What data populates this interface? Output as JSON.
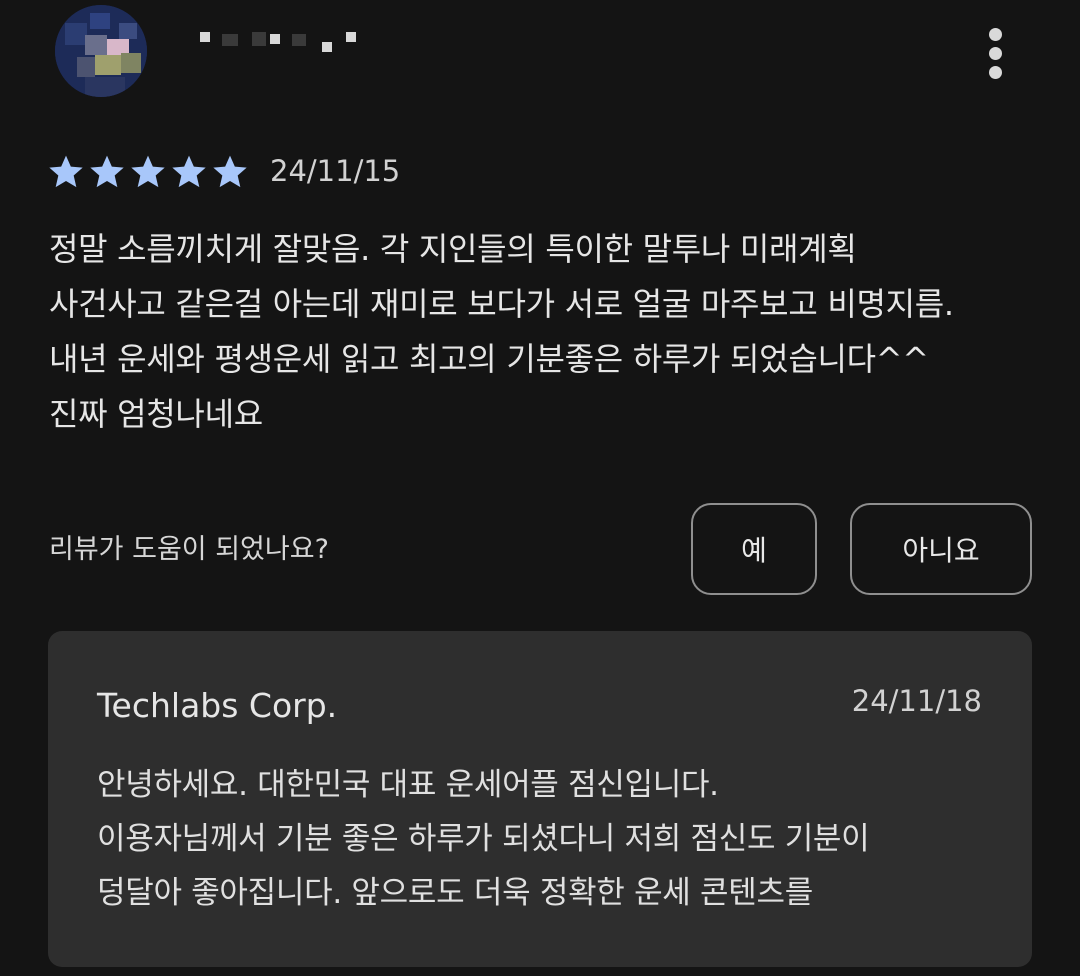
{
  "review": {
    "reviewer_name": "",
    "rating": 5,
    "rating_max": 5,
    "date": "24/11/15",
    "text_lines": [
      "정말 소름끼치게 잘맞음. 각 지인들의 특이한 말투나 미래계획",
      "사건사고 같은걸 아는데 재미로 보다가 서로 얼굴 마주보고 비명지름.",
      "내년 운세와 평생운세 읽고 최고의 기분좋은 하루가 되었습니다^^",
      "진짜 엄청나네요"
    ],
    "more_icon": "more-vert-icon",
    "star_color": "#a8c7fa"
  },
  "helpful": {
    "question": "리뷰가 도움이 되었나요?",
    "yes_label": "예",
    "no_label": "아니요"
  },
  "developer_reply": {
    "name": "Techlabs Corp.",
    "date": "24/11/18",
    "text_lines": [
      "안녕하세요. 대한민국 대표 운세어플 점신입니다.",
      "이용자님께서 기분 좋은 하루가 되셨다니 저희 점신도 기분이",
      "덩달아 좋아집니다. 앞으로도 더욱 정확한 운세 콘텐츠를"
    ]
  }
}
